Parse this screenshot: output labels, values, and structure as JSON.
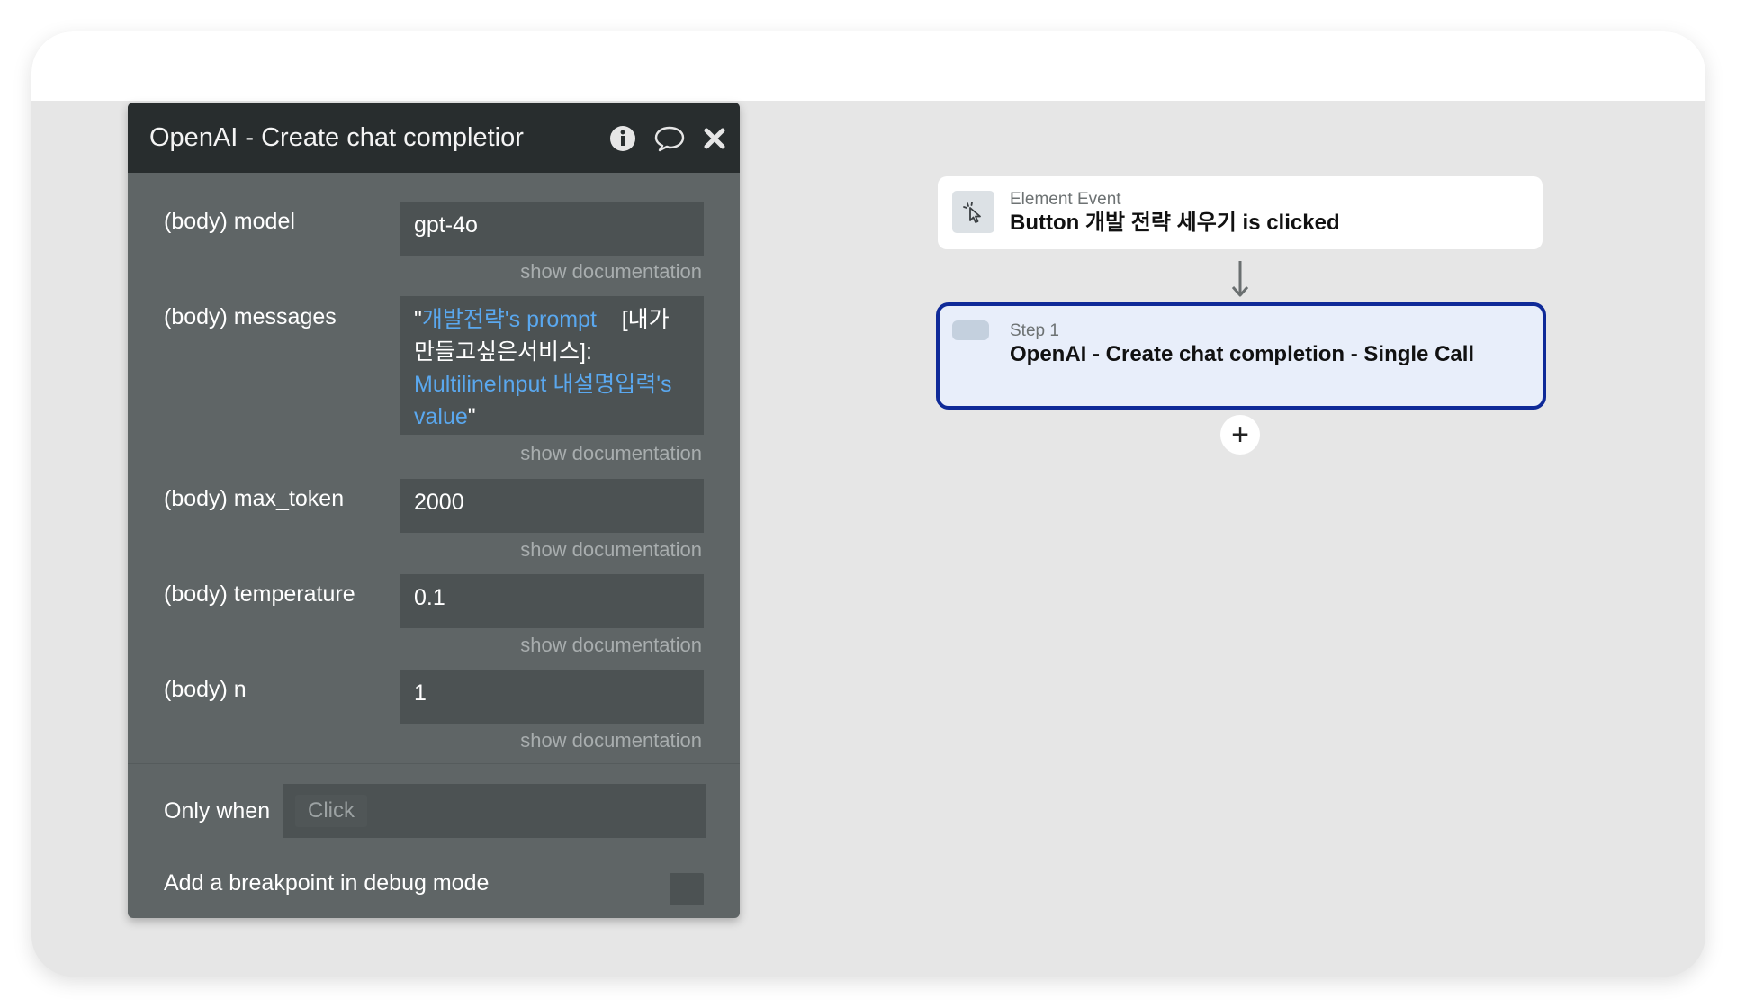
{
  "panel": {
    "title": "OpenAI - Create chat completior",
    "header_icons": [
      "info-icon",
      "comment-icon",
      "close-icon"
    ],
    "fields": [
      {
        "label": "(body) model",
        "value": "gpt-4o",
        "doc": "show documentation"
      },
      {
        "label": "(body) messages",
        "value_parts": [
          {
            "text": "\"",
            "dynamic": false
          },
          {
            "text": "개발전략's prompt",
            "dynamic": true
          },
          {
            "text": "    [내가만들고싶은서비스]: ",
            "dynamic": false
          },
          {
            "text": "MultilineInput 내설명입력's value",
            "dynamic": true
          },
          {
            "text": "\"",
            "dynamic": false
          }
        ],
        "doc": "show documentation"
      },
      {
        "label": "(body) max_token",
        "value": "2000",
        "doc": "show documentation"
      },
      {
        "label": "(body) temperature",
        "value": "0.1",
        "doc": "show documentation"
      },
      {
        "label": "(body) n",
        "value": "1",
        "doc": "show documentation"
      }
    ],
    "only_when": {
      "label": "Only when",
      "placeholder": "Click"
    },
    "breakpoint": {
      "label": "Add a breakpoint in debug mode",
      "checked": false
    }
  },
  "workflow": {
    "event": {
      "type": "Element Event",
      "title": "Button 개발 전략 세우기 is clicked",
      "icon": "cursor-click-icon"
    },
    "step": {
      "label": "Step 1",
      "title": "OpenAI - Create chat completion - Single Call"
    },
    "add_button": "+"
  },
  "colors": {
    "panel_bg": "#5f6566",
    "panel_header": "#282d2e",
    "field_bg": "#4c5253",
    "dynamic_text": "#5aa8ef",
    "step_border": "#0f2a98",
    "step_bg": "#e8eefa",
    "canvas_bg": "#e6e6e6"
  }
}
